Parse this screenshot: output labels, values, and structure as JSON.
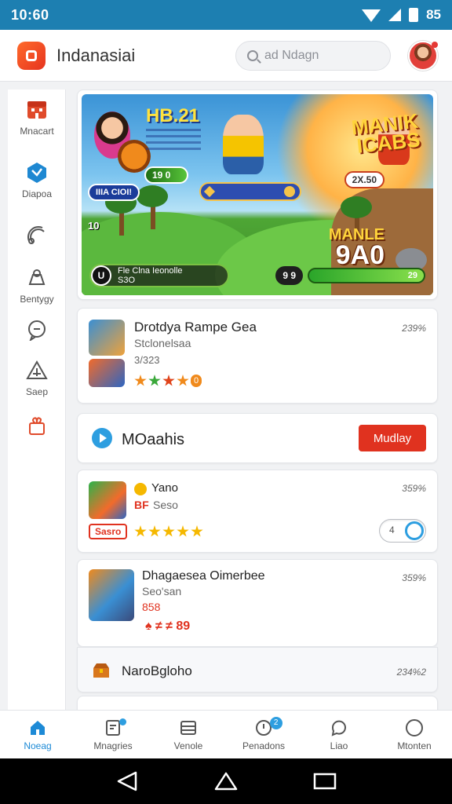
{
  "status_bar": {
    "time": "10:60",
    "battery_text": "85"
  },
  "app_bar": {
    "title": "Indanasiai",
    "search_placeholder": "ad Ndagn"
  },
  "rail": {
    "items": [
      {
        "label": "Mnacart",
        "icon": "store-icon"
      },
      {
        "label": "Diapoa",
        "icon": "puzzle-icon"
      },
      {
        "label": "",
        "icon": "satellite-icon"
      },
      {
        "label": "Bentygy",
        "icon": "bag-icon"
      },
      {
        "label": "",
        "icon": "chat-icon"
      },
      {
        "label": "Saep",
        "icon": "triangle-icon"
      },
      {
        "label": "",
        "icon": "gift-icon"
      }
    ]
  },
  "banner": {
    "headline": "HB.21",
    "green_pill": "19 0",
    "blue_pill": "IIIA CIOI!",
    "left_counter": "10",
    "logo_line1": "MANIK",
    "logo_line2": "ICABS",
    "score_pill": "2X.50",
    "big_name": "MANLE",
    "big_number": "9A0",
    "hud_badge": "U",
    "hud_text": "Fle Clna Ieonolle",
    "hud_sub": "S3O",
    "hud_chip": "9 9",
    "hud_meter": "29"
  },
  "games": [
    {
      "title": "Drotdya Rampe Gea",
      "subtitle": "Stclonelsaa",
      "meta": "3/323",
      "percent": "239%",
      "rating_badge": "0"
    },
    {
      "title": "Yano",
      "subtitle": "Seso",
      "tag": "Sasro",
      "percent": "359%",
      "toggle_label": "4",
      "prefix": "BF"
    },
    {
      "title": "Dhagaesea Oimerbee",
      "subtitle": "Seo'san",
      "meta": "858",
      "stat": "♠ ≠ ≠ 89",
      "percent": "359%"
    }
  ],
  "section": {
    "title": "MOaahis",
    "button": "Mudlay"
  },
  "list_row": {
    "title": "NaroBgloho",
    "percent": "234%2"
  },
  "bottom_nav": {
    "items": [
      {
        "label": "Noeag",
        "icon": "home-icon",
        "active": true
      },
      {
        "label": "Mnagries",
        "icon": "document-icon",
        "badge": ""
      },
      {
        "label": "Venole",
        "icon": "list-icon"
      },
      {
        "label": "Penadons",
        "icon": "clock-icon",
        "badge": "2"
      },
      {
        "label": "Liao",
        "icon": "chat-bubble-icon"
      },
      {
        "label": "Mtonten",
        "icon": "circle-icon"
      }
    ]
  },
  "colors": {
    "status_bar": "#1d7fb1",
    "accent": "#2d9ee0",
    "brand": "#e6341f"
  }
}
